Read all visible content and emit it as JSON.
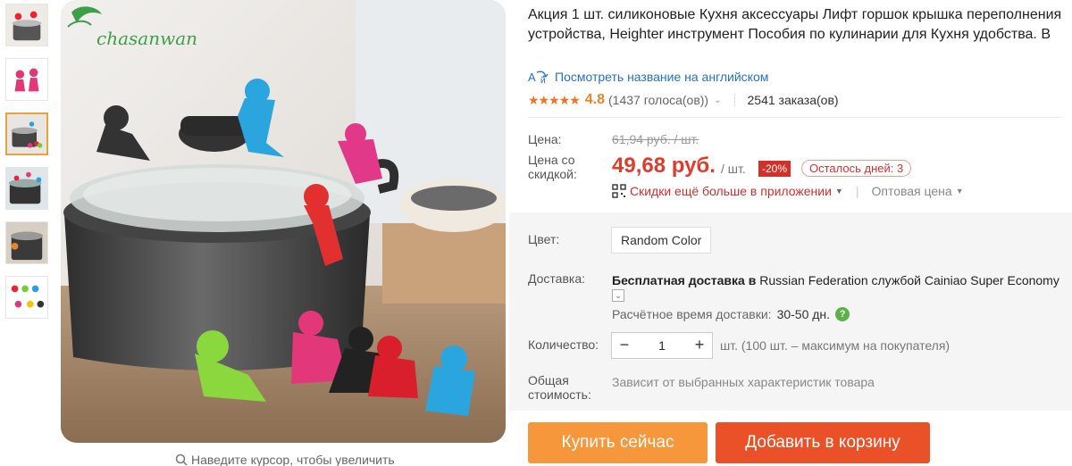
{
  "gallery": {
    "thumbnails": [
      "thumb-1",
      "thumb-2",
      "thumb-3",
      "thumb-4",
      "thumb-5",
      "thumb-6"
    ],
    "active_index": 2,
    "brand_logo": "chasanwan",
    "zoom_hint": "Наведите курсор, чтобы увеличить"
  },
  "product": {
    "title": "Акция 1 шт. силиконовые Кухня аксессуары Лифт горшок крышка переполнения устройства, Heighter инструмент Пособия по кулинарии для Кухня удобства. В",
    "translate_link": "Посмотреть название на английском",
    "rating": "4.8",
    "votes": "(1437 голоса(ов))",
    "orders": "2541 заказа(ов)"
  },
  "price": {
    "price_label": "Цена:",
    "old_price": "61,94 руб. / шт.",
    "discount_label": "Цена со скидкой:",
    "new_price": "49,68 руб.",
    "unit": "/ шт.",
    "discount": "-20%",
    "days_left": "Осталось дней: 3",
    "app_deal": "Скидки ещё больше в приложении",
    "wholesale": "Оптовая цена"
  },
  "options": {
    "color_label": "Цвет:",
    "color_value": "Random Color",
    "shipping_label": "Доставка:",
    "shipping_free": "Бесплатная доставка в",
    "shipping_rest": "Russian Federation службой Cainiao Super Economy",
    "eta_label": "Расчётное время доставки:",
    "eta_value": "30-50 дн.",
    "qty_label": "Количество:",
    "qty_value": "1",
    "qty_minus": "−",
    "qty_plus": "+",
    "qty_note": "шт. (100 шт. – максимум на покупателя)",
    "total_label": "Общая стоимость:",
    "total_note": "Зависит от выбранных характеристик товара"
  },
  "actions": {
    "buy_now": "Купить сейчас",
    "add_to_cart": "Добавить в корзину"
  },
  "colors": {
    "price_red": "#e03c2d",
    "buy_orange": "#f5973a",
    "cart_red": "#ea5128",
    "link_blue": "#2670c9",
    "star_orange": "#f57224"
  }
}
